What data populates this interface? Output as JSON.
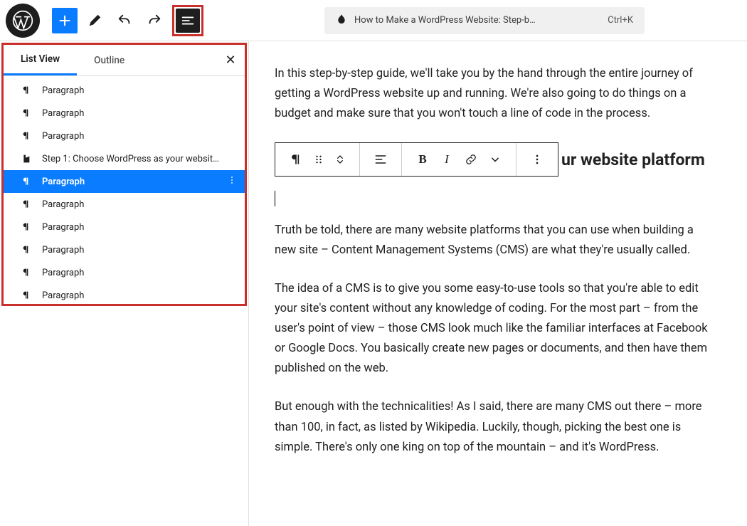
{
  "header": {
    "title": "How to Make a WordPress Website: Step-b…",
    "shortcut": "Ctrl+K"
  },
  "panel": {
    "tab_list_view": "List View",
    "tab_outline": "Outline",
    "close": "✕"
  },
  "list_view": {
    "items": [
      {
        "type": "paragraph",
        "label": "Paragraph"
      },
      {
        "type": "paragraph",
        "label": "Paragraph"
      },
      {
        "type": "paragraph",
        "label": "Paragraph"
      },
      {
        "type": "heading",
        "label": "Step 1: Choose WordPress as your website …"
      },
      {
        "type": "paragraph",
        "label": "Paragraph",
        "selected": true
      },
      {
        "type": "paragraph",
        "label": "Paragraph"
      },
      {
        "type": "paragraph",
        "label": "Paragraph"
      },
      {
        "type": "paragraph",
        "label": "Paragraph"
      },
      {
        "type": "paragraph",
        "label": "Paragraph"
      },
      {
        "type": "paragraph",
        "label": "Paragraph"
      }
    ]
  },
  "content": {
    "p1": "In this step-by-step guide, we'll take you by the hand through the entire journey of getting a WordPress website up and running. We're also going to do things on a budget and make sure that you won't touch a line of code in the process.",
    "h2_partial": "ur website platform",
    "p3": "Truth be told, there are many website platforms that you can use when building a new site – Content Management Systems (CMS) are what they're usually called.",
    "p4": "The idea of a CMS is to give you some easy-to-use tools so that you're able to edit your site's content without any knowledge of coding. For the most part – from the user's point of view – those CMS look much like the familiar interfaces at Facebook or Google Docs. You basically create new pages or documents, and then have them published on the web.",
    "p5": "But enough with the technicalities! As I said, there are many CMS out there – more than 100, in fact, as listed by Wikipedia. Luckily, though, picking the best one is simple. There's only one king on top of the mountain – and it's WordPress."
  },
  "toolbar_labels": {
    "bold": "B",
    "italic": "I"
  }
}
